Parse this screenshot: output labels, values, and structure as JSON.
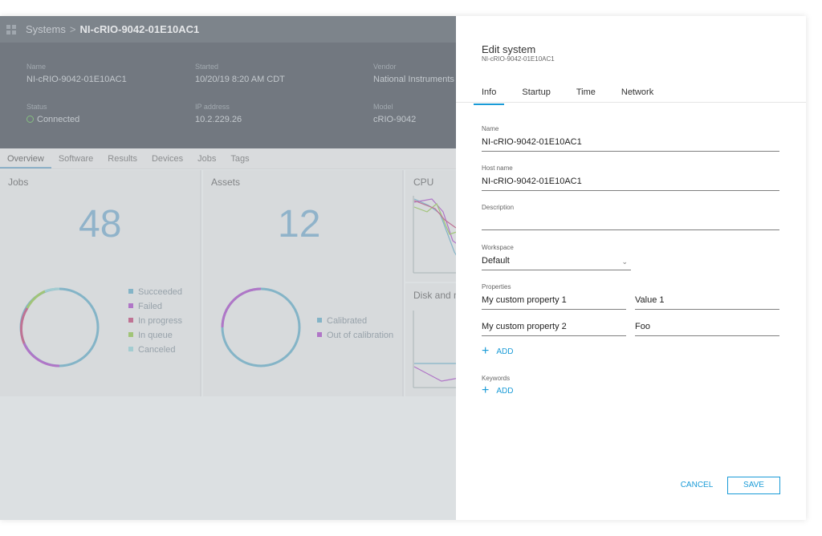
{
  "breadcrumb": {
    "root": "Systems",
    "separator": ">",
    "current": "NI-cRIO-9042-01E10AC1"
  },
  "system_info": {
    "name_label": "Name",
    "name": "NI-cRIO-9042-01E10AC1",
    "started_label": "Started",
    "started": "10/20/19 8:20 AM CDT",
    "vendor_label": "Vendor",
    "vendor": "National Instruments",
    "status_label": "Status",
    "status": "Connected",
    "ip_label": "IP address",
    "ip": "10.2.229.26",
    "model_label": "Model",
    "model": "cRIO-9042"
  },
  "page_tabs": [
    "Overview",
    "Software",
    "Results",
    "Devices",
    "Jobs",
    "Tags"
  ],
  "cards": {
    "jobs": {
      "title": "Jobs",
      "count": "48",
      "legend": [
        {
          "label": "Succeeded",
          "color": "#5aa9c6"
        },
        {
          "label": "Failed",
          "color": "#a63fc6"
        },
        {
          "label": "In progress",
          "color": "#c0396f"
        },
        {
          "label": "In queue",
          "color": "#8cc43f"
        },
        {
          "label": "Canceled",
          "color": "#8fd3d8"
        }
      ]
    },
    "assets": {
      "title": "Assets",
      "count": "12",
      "legend": [
        {
          "label": "Calibrated",
          "color": "#5aa9c6"
        },
        {
          "label": "Out of calibration",
          "color": "#a63fc6"
        }
      ]
    },
    "cpu": {
      "title": "CPU"
    },
    "disk": {
      "title": "Disk and m"
    }
  },
  "dialog": {
    "title": "Edit system",
    "subtitle": "NI-cRIO-9042-01E10AC1",
    "tabs": [
      "Info",
      "Startup",
      "Time",
      "Network"
    ],
    "active_tab": "Info",
    "name_label": "Name",
    "name_value": "NI-cRIO-9042-01E10AC1",
    "host_label": "Host name",
    "host_value": "NI-cRIO-9042-01E10AC1",
    "description_label": "Description",
    "description_value": "",
    "workspace_label": "Workspace",
    "workspace_value": "Default",
    "properties_label": "Properties",
    "properties": [
      {
        "name": "My custom property 1",
        "value": "Value 1"
      },
      {
        "name": "My custom property 2",
        "value": "Foo"
      }
    ],
    "add_label": "ADD",
    "keywords_label": "Keywords",
    "cancel_label": "CANCEL",
    "save_label": "SAVE"
  },
  "colors": {
    "accent": "#1a9bd7",
    "header_bg": "#3b434c",
    "topbar_bg": "#4f5660"
  }
}
